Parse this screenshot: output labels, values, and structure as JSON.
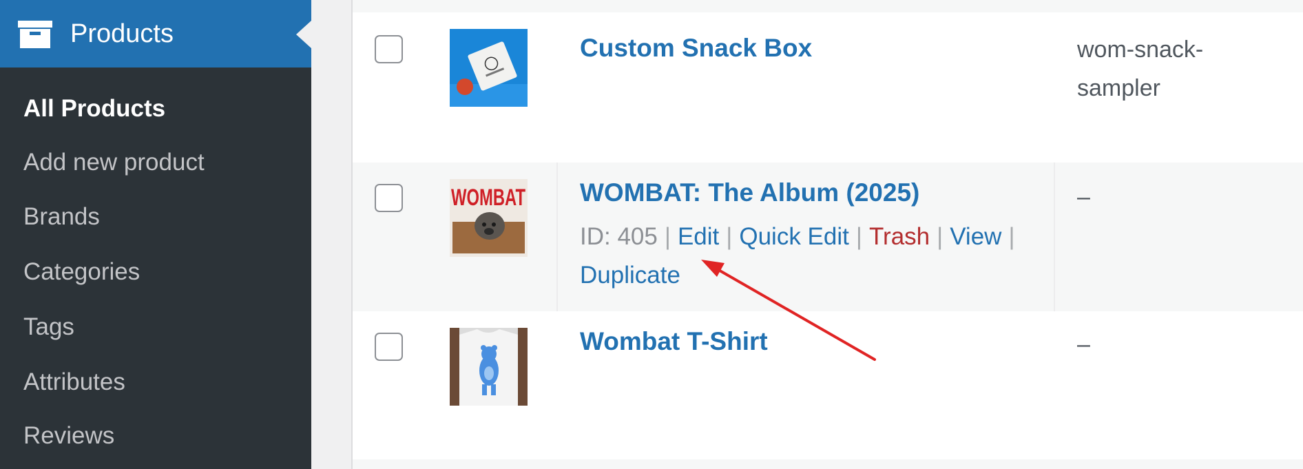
{
  "sidebar": {
    "header_label": "Products",
    "items": [
      {
        "label": "All Products",
        "current": true
      },
      {
        "label": "Add new product",
        "current": false
      },
      {
        "label": "Brands",
        "current": false
      },
      {
        "label": "Categories",
        "current": false
      },
      {
        "label": "Tags",
        "current": false
      },
      {
        "label": "Attributes",
        "current": false
      },
      {
        "label": "Reviews",
        "current": false
      }
    ]
  },
  "products": [
    {
      "name": "Custom Snack Box",
      "sku": "wom-snack-sampler",
      "thumbnail": "snack-box-photo"
    },
    {
      "name": "WOMBAT: The Album (2025)",
      "sku": "–",
      "thumbnail": "wombat-album-cover",
      "thumb_text": "WOMBAT",
      "actions": {
        "id": "ID: 405",
        "edit": "Edit",
        "quick_edit": "Quick Edit",
        "trash": "Trash",
        "view": "View",
        "duplicate": "Duplicate"
      }
    },
    {
      "name": "Wombat T-Shirt",
      "sku": "–",
      "thumbnail": "wombat-tshirt-photo"
    }
  ],
  "colors": {
    "sidebar_bg": "#2c3338",
    "sidebar_active": "#2271b1",
    "link": "#2271b1",
    "trash": "#b32d2e",
    "annotation_arrow": "#e02424"
  }
}
